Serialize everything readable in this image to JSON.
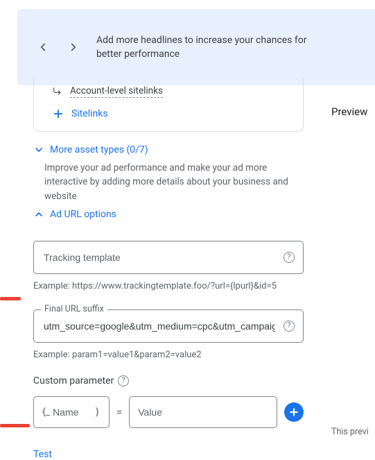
{
  "banner": {
    "message": "Add more headlines to increase your chances for better performance"
  },
  "card": {
    "account_sitelinks_label": "Account-level sitelinks",
    "sitelinks_label": "Sitelinks"
  },
  "expanders": {
    "more_asset_types": "More asset types (0/7)",
    "more_asset_help": "Improve your ad performance and make your ad more interactive by adding more details about your business and website",
    "url_options": "Ad URL options"
  },
  "tracking": {
    "placeholder": "Tracking template",
    "example": "Example: https://www.trackingtemplate.foo/?url={lpurl}&id=5"
  },
  "suffix": {
    "label": "Final URL suffix",
    "value": "utm_source=google&utm_medium=cpc&utm_campaign={ca",
    "example": "Example: param1=value1&param2=value2"
  },
  "custom_param": {
    "label": "Custom parameter",
    "brace_open": "{_",
    "name_placeholder": "Name",
    "brace_close": "}",
    "eq": "=",
    "value_placeholder": "Value"
  },
  "test_label": "Test",
  "preview": {
    "title": "Preview",
    "note": "This previ"
  }
}
